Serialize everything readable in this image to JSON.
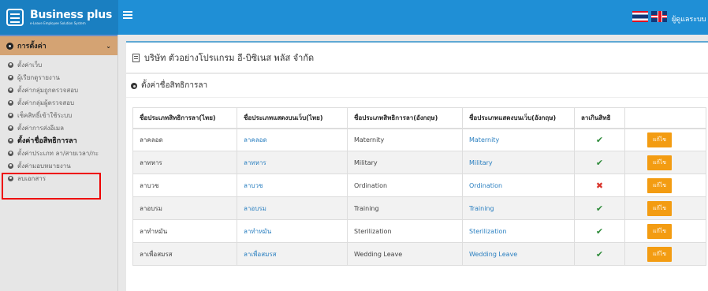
{
  "header": {
    "brand_name": "Business plus",
    "brand_sub": "e-Leave Employee Solution System",
    "user_link": "ผู้ดูแลระบบ"
  },
  "sidebar": {
    "section_title": "การตั้งค่า",
    "items": [
      {
        "label": "ตั้งค่าเว็บ"
      },
      {
        "label": "ผู้เรียกดูรายงาน"
      },
      {
        "label": "ตั้งค่ากลุ่มถูกตรวจสอบ"
      },
      {
        "label": "ตั้งค่ากลุ่มผู้ตรวจสอบ"
      },
      {
        "label": "เช็คสิทธิ์เข้าใช้ระบบ"
      },
      {
        "label": "ตั้งค่าการส่งอีเมล"
      },
      {
        "label": "ตั้งค่าชื่อสิทธิการลา",
        "active": true
      },
      {
        "label": "ตั้งค่าประเภท ลา/สายเวลา/กะ"
      },
      {
        "label": "ตั้งค่ามอบหมายงาน"
      },
      {
        "label": "ลบเอกสาร"
      }
    ]
  },
  "company": {
    "name": "บริษัท ตัวอย่างโปรแกรม อี-บิซิเนส พลัส จำกัด"
  },
  "panel": {
    "title": "ตั้งค่าชื่อสิทธิการลา"
  },
  "table": {
    "headers": [
      "ชื่อประเภทสิทธิการลา(ไทย)",
      "ชื่อประเภทแสดงบนเว็บ(ไทย)",
      "ชื่อประเภทสิทธิการลา(อังกฤษ)",
      "ชื่อประเภทแสดงบนเว็บ(อังกฤษ)",
      "ลาเกินสิทธิ",
      ""
    ],
    "rows": [
      {
        "th_name": "ลาคลอด",
        "th_web": "ลาคลอด",
        "en_name": "Maternity",
        "en_web": "Maternity",
        "over": "✔",
        "over_ok": true,
        "edit": "แก้ไข"
      },
      {
        "th_name": "ลาทหาร",
        "th_web": "ลาทหาร",
        "en_name": "Military",
        "en_web": "Military",
        "over": "✔",
        "over_ok": true,
        "edit": "แก้ไข"
      },
      {
        "th_name": "ลาบวช",
        "th_web": "ลาบวช",
        "en_name": "Ordination",
        "en_web": "Ordination",
        "over": "✖",
        "over_ok": false,
        "edit": "แก้ไข"
      },
      {
        "th_name": "ลาอบรม",
        "th_web": "ลาอบรม",
        "en_name": "Training",
        "en_web": "Training",
        "over": "✔",
        "over_ok": true,
        "edit": "แก้ไข"
      },
      {
        "th_name": "ลาทำหมัน",
        "th_web": "ลาทำหมัน",
        "en_name": "Sterilization",
        "en_web": "Sterilization",
        "over": "✔",
        "over_ok": true,
        "edit": "แก้ไข"
      },
      {
        "th_name": "ลาเพื่อสมรส",
        "th_web": "ลาเพื่อสมรส",
        "en_name": "Wedding Leave",
        "en_web": "Wedding Leave",
        "over": "✔",
        "over_ok": true,
        "edit": "แก้ไข"
      }
    ]
  },
  "colors": {
    "header_blue": "#1f8fd6",
    "link_blue": "#2a7fc0",
    "edit_orange": "#f39c12",
    "check_green": "#2e8b3a",
    "cross_red": "#d9342b",
    "highlight_red": "#e00000"
  },
  "icons": {
    "brand": "document-list-icon",
    "menu": "hamburger-icon",
    "settings": "gear-icon",
    "company": "document-icon",
    "flag_th": "thai-flag-icon",
    "flag_en": "uk-flag-icon"
  }
}
